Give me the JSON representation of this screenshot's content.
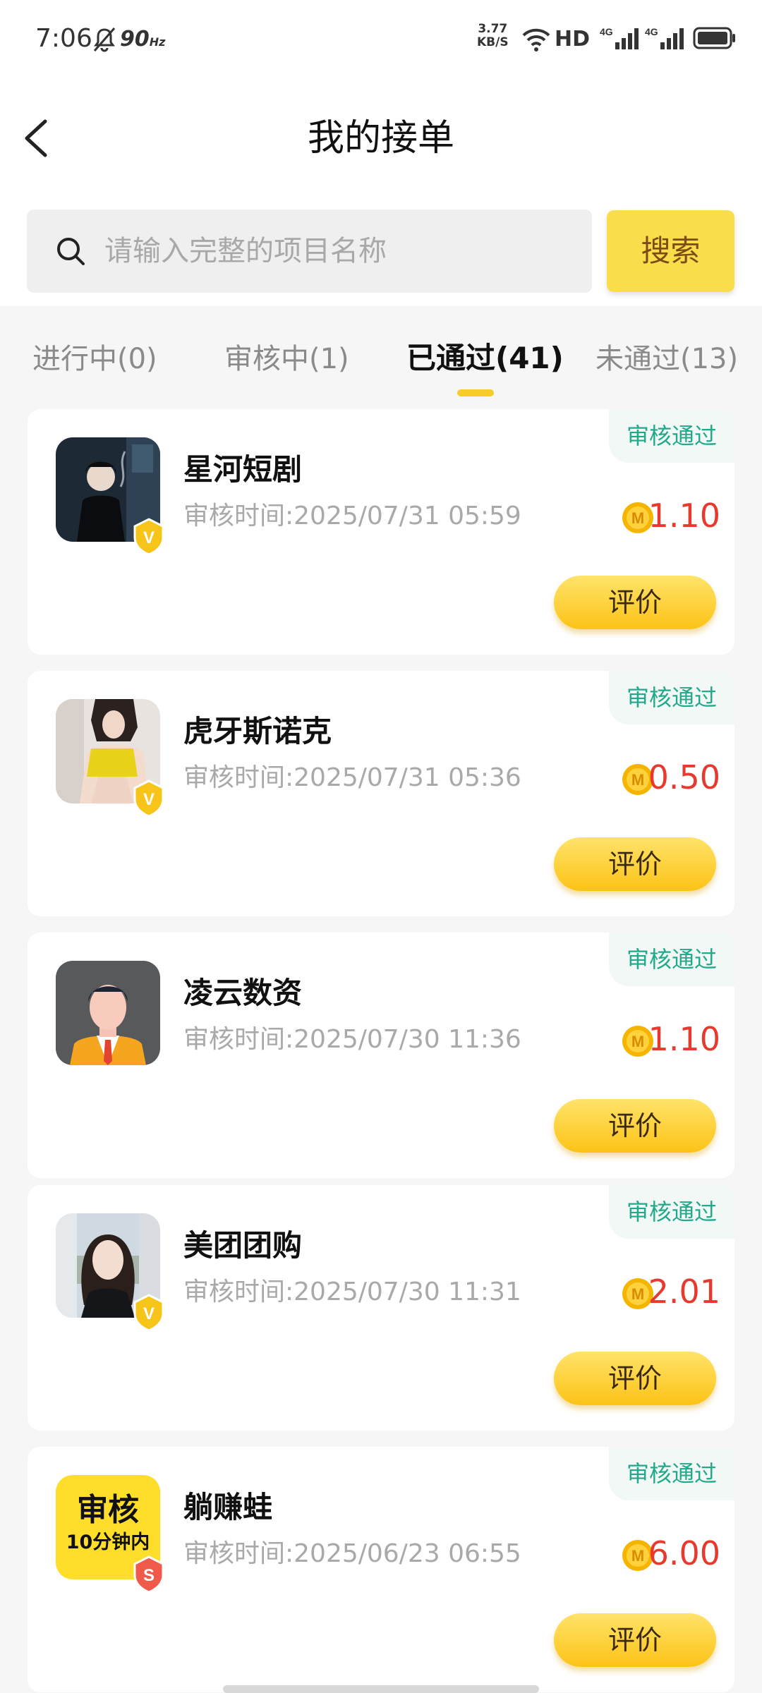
{
  "status_bar": {
    "time": "7:06",
    "refresh_rate": "90",
    "refresh_unit": "Hz",
    "net_speed": "3.77",
    "net_unit": "KB/S",
    "hd_label": "HD",
    "signal_label": "4G"
  },
  "header": {
    "title": "我的接单"
  },
  "search": {
    "placeholder": "请输入完整的项目名称",
    "button_label": "搜索"
  },
  "tabs": [
    {
      "label": "进行中(0)",
      "active": false
    },
    {
      "label": "审核中(1)",
      "active": false
    },
    {
      "label": "已通过(41)",
      "active": true
    },
    {
      "label": "未通过(13)",
      "active": false
    }
  ],
  "orders": [
    {
      "title": "星河短剧",
      "time": "审核时间:2025/07/31 05:59",
      "status": "审核通过",
      "amount": "1.10",
      "action": "评价",
      "thumb_icon": "smoking-person-avatar",
      "badge": "V"
    },
    {
      "title": "虎牙斯诺克",
      "time": "审核时间:2025/07/31 05:36",
      "status": "审核通过",
      "amount": "0.50",
      "action": "评价",
      "thumb_icon": "woman-yellow-top-avatar",
      "badge": "V"
    },
    {
      "title": "凌云数资",
      "time": "审核时间:2025/07/30 11:36",
      "status": "审核通过",
      "amount": "1.10",
      "action": "评价",
      "thumb_icon": "businessman-avatar",
      "badge": ""
    },
    {
      "title": "美团团购",
      "time": "审核时间:2025/07/30 11:31",
      "status": "审核通过",
      "amount": "2.01",
      "action": "评价",
      "thumb_icon": "woman-portrait-avatar",
      "badge": "V"
    },
    {
      "title": "躺赚蛙",
      "time": "审核时间:2025/06/23 06:55",
      "status": "审核通过",
      "amount": "6.00",
      "action": "评价",
      "thumb_icon": "review-promo-thumb",
      "badge": "S",
      "thumb_text_line1": "审核",
      "thumb_text_line2": "10分钟内"
    }
  ],
  "coin_label": "M",
  "colors": {
    "accent_yellow": "#fadd4b",
    "button_yellow": "#fcc316",
    "amount_red": "#e8392e",
    "status_green": "#22a98a",
    "tab_indicator": "#f5cc2b"
  }
}
